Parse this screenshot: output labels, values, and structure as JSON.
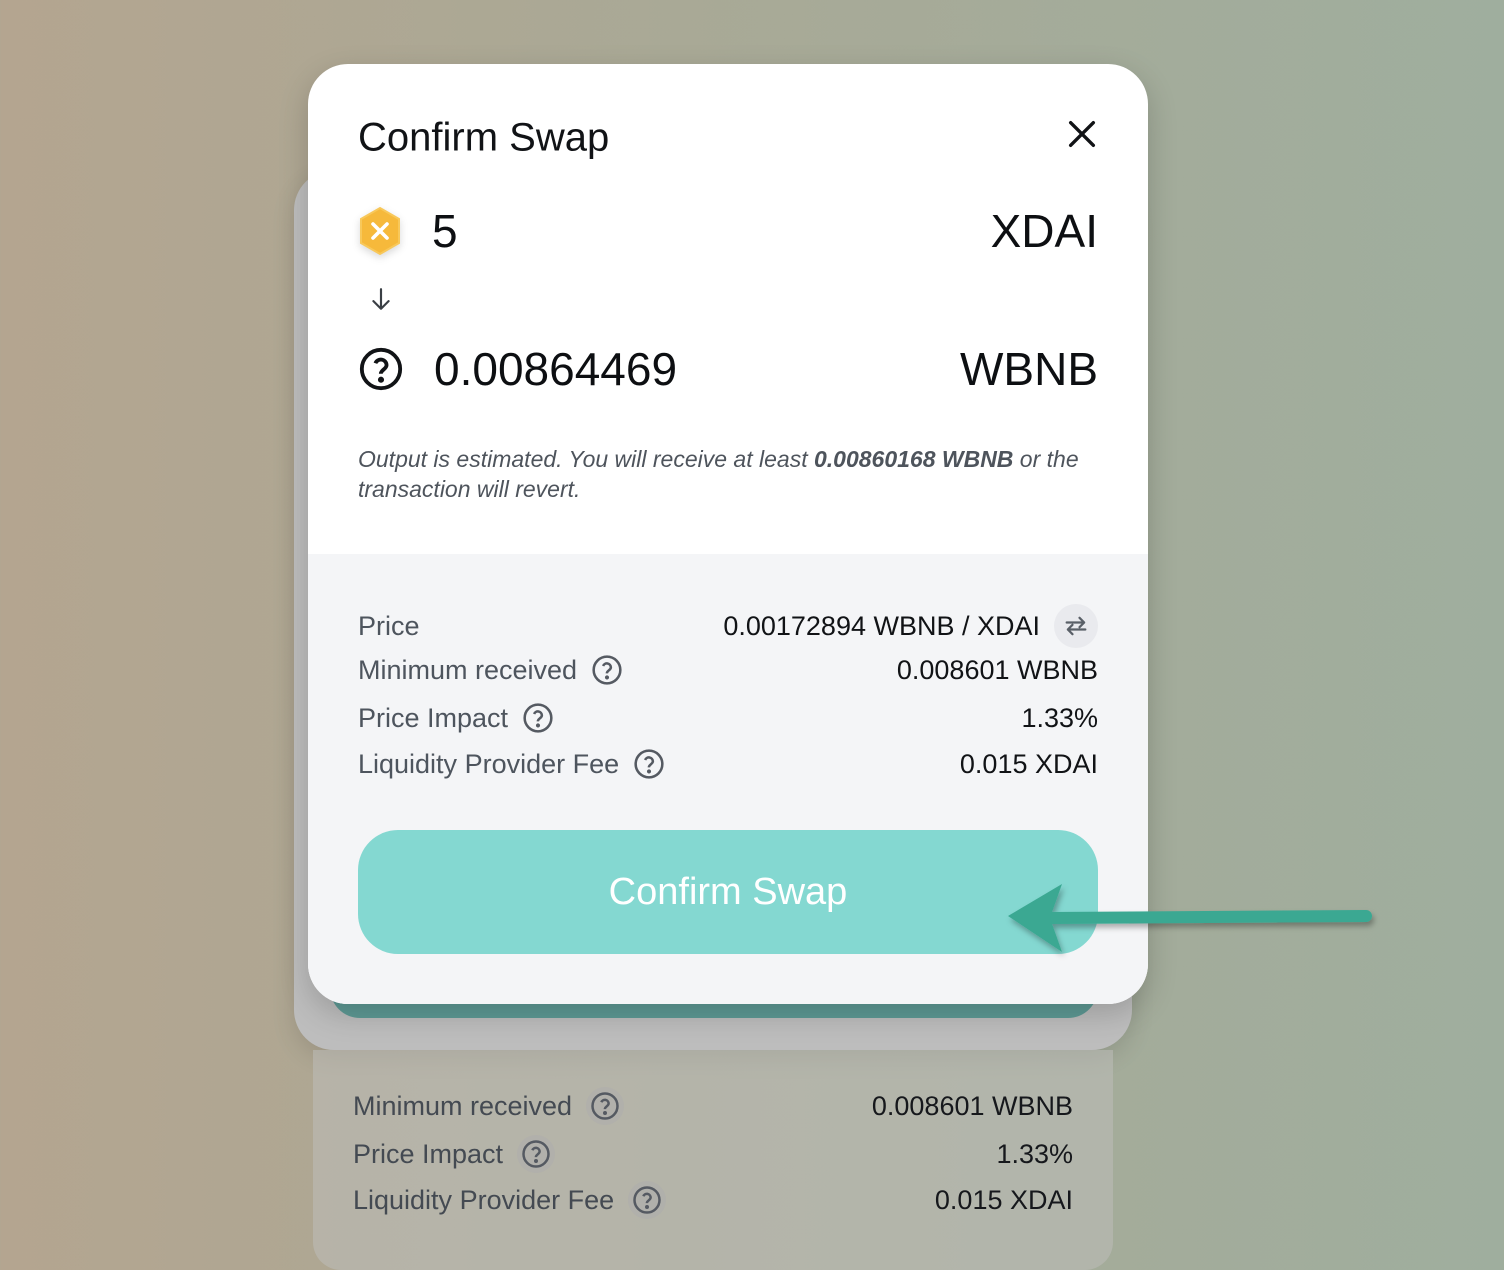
{
  "background": {
    "details": [
      {
        "label": "Minimum received",
        "value": "0.008601 WBNB"
      },
      {
        "label": "Price Impact",
        "value": "1.33%"
      },
      {
        "label": "Liquidity Provider Fee",
        "value": "0.015 XDAI"
      }
    ]
  },
  "modal": {
    "title": "Confirm Swap",
    "input": {
      "amount": "5",
      "symbol": "XDAI",
      "icon": "xdai-token-icon"
    },
    "output": {
      "amount": "0.00864469",
      "symbol": "WBNB",
      "icon": "unknown-token-icon"
    },
    "estimate": {
      "prefix": "Output is estimated. You will receive at least ",
      "min_amount": "0.00860168 WBNB",
      "suffix": " or the transaction will revert."
    },
    "details": {
      "price_label": "Price",
      "price_value": "0.00172894 WBNB / XDAI",
      "min_received_label": "Minimum received",
      "min_received_value": "0.008601 WBNB",
      "price_impact_label": "Price Impact",
      "price_impact_value": "1.33%",
      "lp_fee_label": "Liquidity Provider Fee",
      "lp_fee_value": "0.015 XDAI"
    },
    "confirm_label": "Confirm Swap"
  },
  "colors": {
    "accent": "#84d8d1",
    "annotation_arrow": "#3aa892"
  }
}
